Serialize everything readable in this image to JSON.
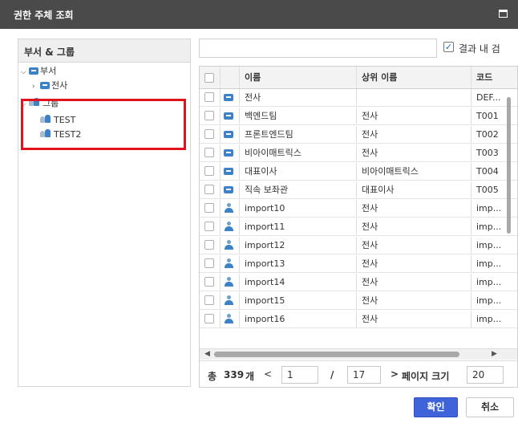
{
  "window": {
    "title": "권한 주체 조회"
  },
  "left": {
    "header": "부서 & 그룹",
    "tree": {
      "dept_label": "부서",
      "dept_child": "전사",
      "group_label": "그룹",
      "group_children": [
        "TEST",
        "TEST2"
      ]
    }
  },
  "search": {
    "value": "",
    "placeholder": ""
  },
  "result_in": {
    "label": "결과 내 검",
    "checked": true
  },
  "grid": {
    "columns": [
      "이름",
      "상위 이름",
      "코드"
    ],
    "rows": [
      {
        "type": "org",
        "name": "전사",
        "parent": "",
        "code": "DEF..."
      },
      {
        "type": "org",
        "name": "백엔드팀",
        "parent": "전사",
        "code": "T001"
      },
      {
        "type": "org",
        "name": "프론트엔드팀",
        "parent": "전사",
        "code": "T002"
      },
      {
        "type": "org",
        "name": "비아이매트릭스",
        "parent": "전사",
        "code": "T003"
      },
      {
        "type": "org",
        "name": "대표이사",
        "parent": "비아이매트릭스",
        "code": "T004"
      },
      {
        "type": "org",
        "name": "직속 보좌관",
        "parent": "대표이사",
        "code": "T005"
      },
      {
        "type": "user",
        "name": "import10",
        "parent": "전사",
        "code": "imp..."
      },
      {
        "type": "user",
        "name": "import11",
        "parent": "전사",
        "code": "imp..."
      },
      {
        "type": "user",
        "name": "import12",
        "parent": "전사",
        "code": "imp..."
      },
      {
        "type": "user",
        "name": "import13",
        "parent": "전사",
        "code": "imp..."
      },
      {
        "type": "user",
        "name": "import14",
        "parent": "전사",
        "code": "imp..."
      },
      {
        "type": "user",
        "name": "import15",
        "parent": "전사",
        "code": "imp..."
      },
      {
        "type": "user",
        "name": "import16",
        "parent": "전사",
        "code": "imp..."
      }
    ]
  },
  "pager": {
    "total_prefix": "총",
    "total_count": "339",
    "total_unit": "개",
    "prev": "<",
    "current_page": "1",
    "slash": "/",
    "total_pages": "17",
    "next": ">",
    "page_size_label": "페이지 크기",
    "page_size": "20"
  },
  "buttons": {
    "ok": "확인",
    "cancel": "취소"
  },
  "colors": {
    "titlebar": "#4a4a4a",
    "primary_button": "#3f63d8",
    "highlight": "#e0131e",
    "icon_blue": "#3c82c8"
  }
}
